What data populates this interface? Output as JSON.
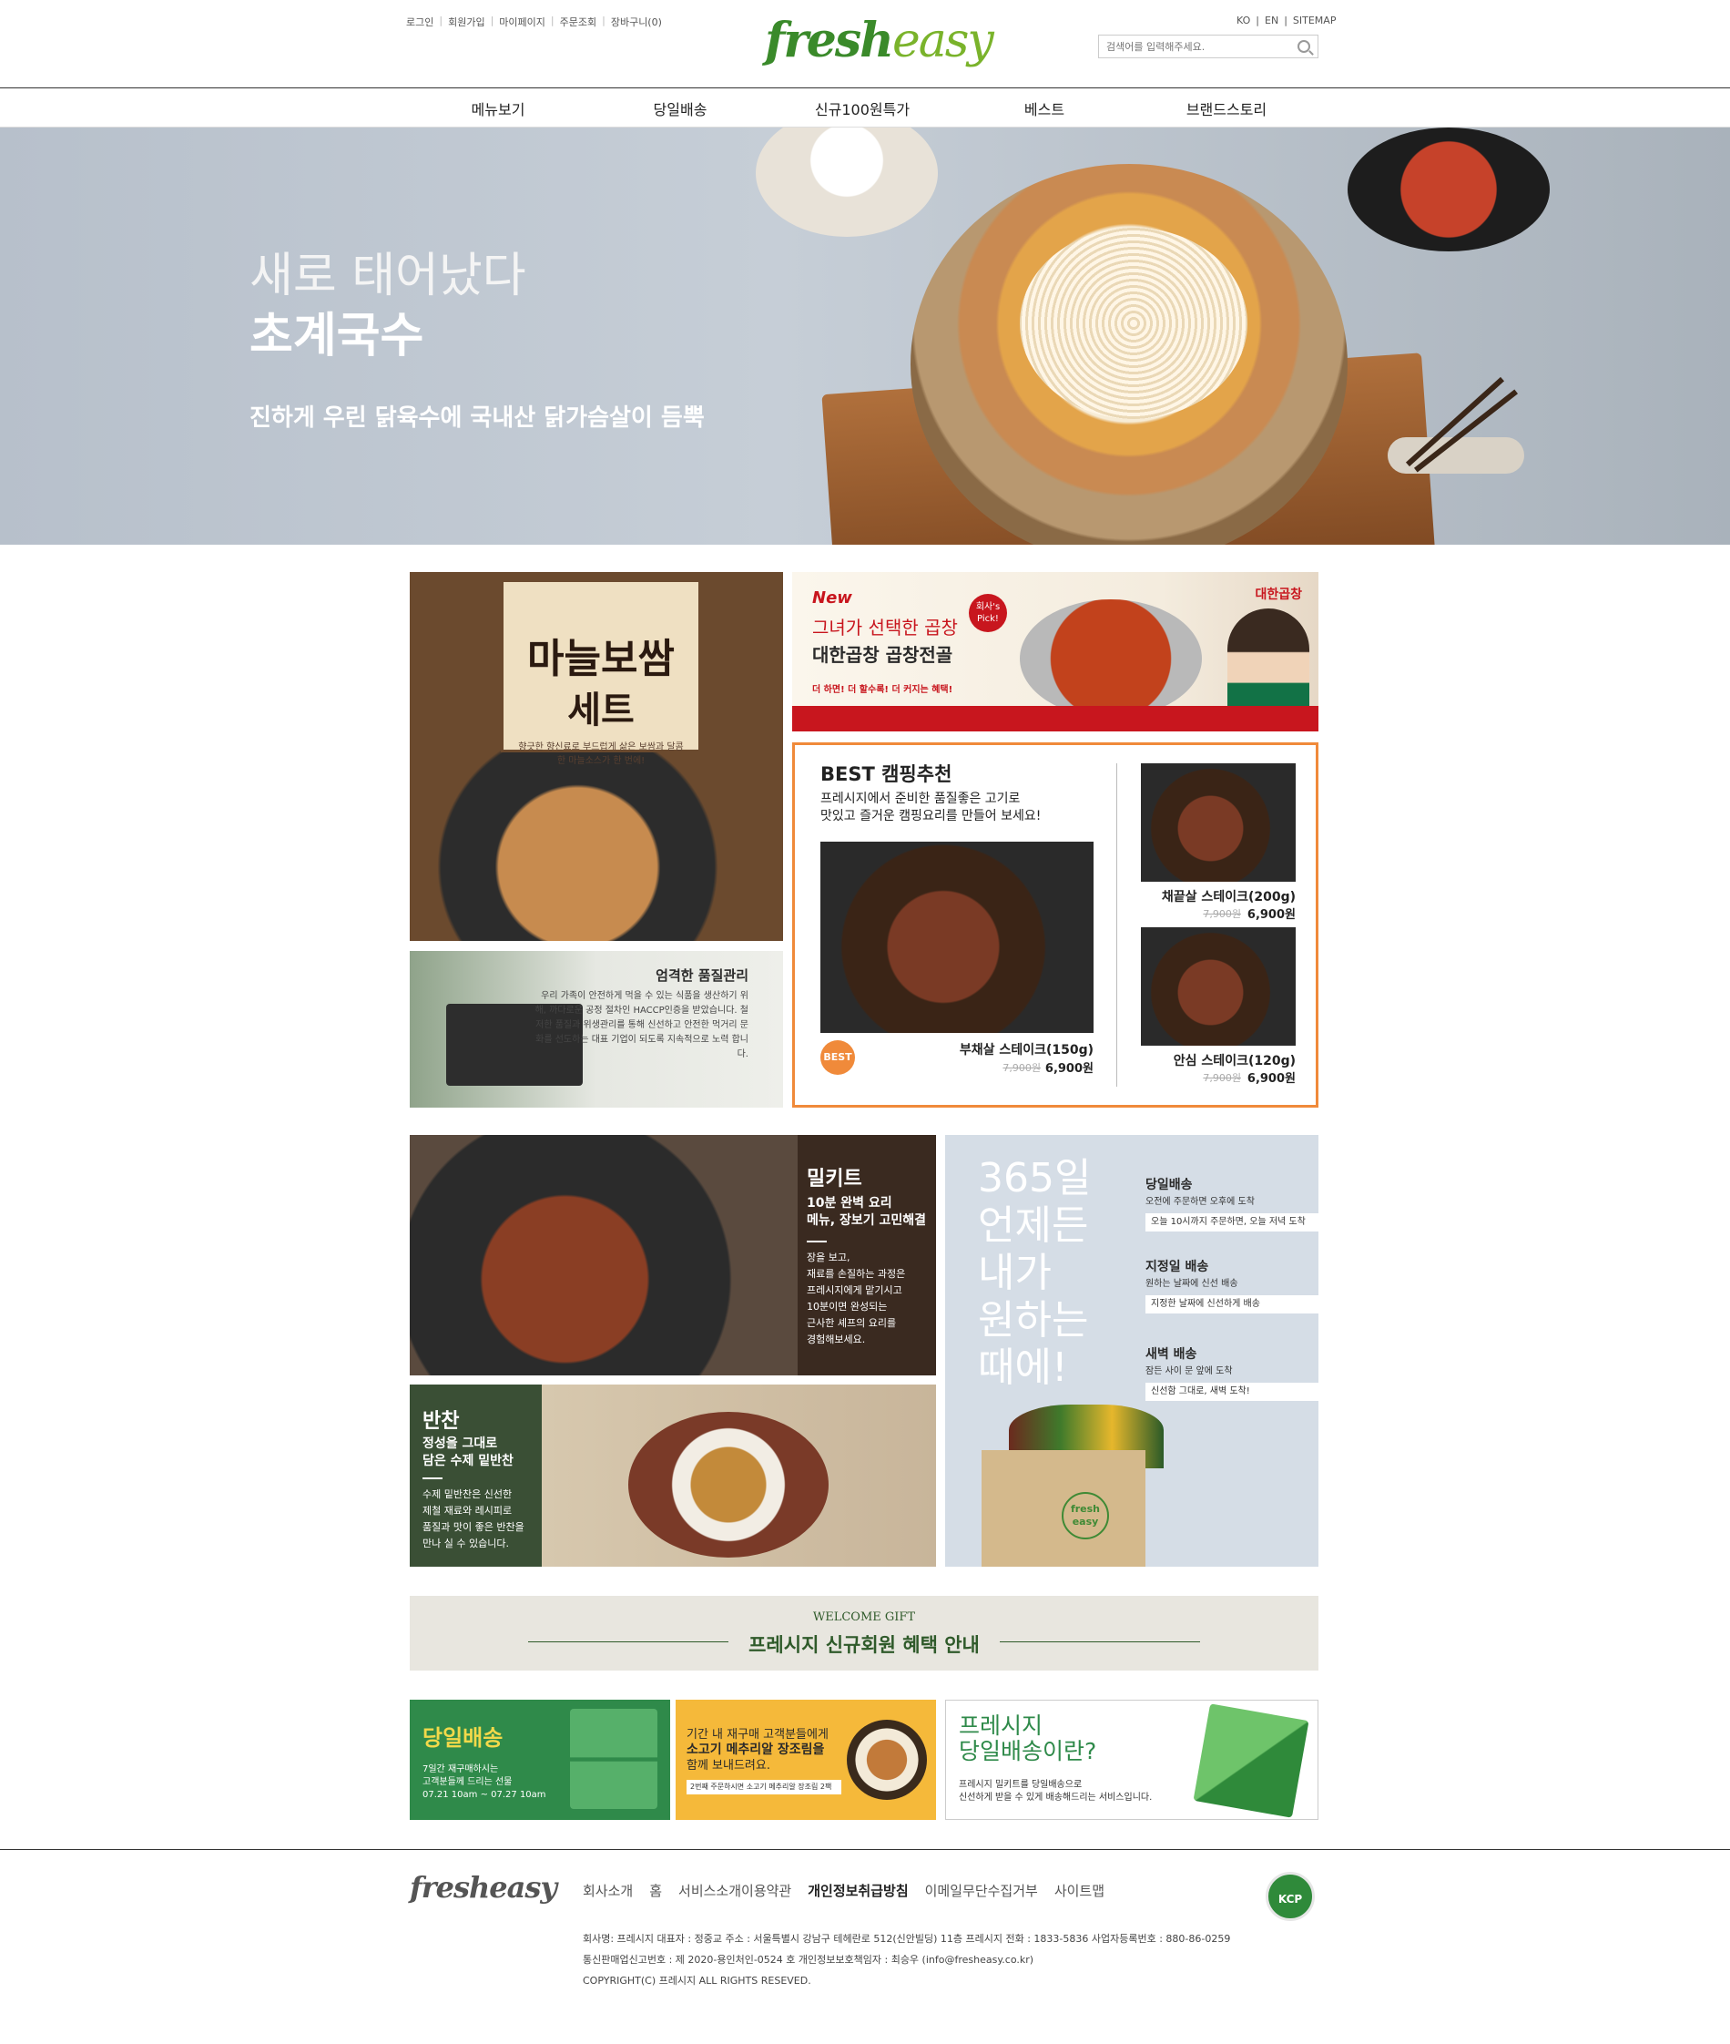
{
  "header": {
    "util_left": [
      "로그인",
      "회원가입",
      "마이페이지",
      "주문조회",
      "장바구니(0)"
    ],
    "logo_a": "fresh",
    "logo_b": "easy",
    "util_right": [
      "KO",
      "EN",
      "SITEMAP"
    ],
    "search_placeholder": "검색어를 입력해주세요."
  },
  "nav": [
    "메뉴보기",
    "당일배송",
    "신규100원특가",
    "베스트",
    "브랜드스토리"
  ],
  "hero": {
    "sub": "새로 태어났다",
    "title": "초계국수",
    "desc": "진하게 우린 닭육수에 국내산 닭가슴살이 듬뿍"
  },
  "bossam": {
    "title1": "마늘보쌈",
    "title2": "세트",
    "desc": "향긋한 향신료로 부드럽게 삶은 보쌈과 달콤한 마늘소스가 한 번에!"
  },
  "quality": {
    "title": "엄격한 품질관리",
    "desc": "우리 가족이 안전하게 먹을 수 있는 식품을 생산하기 위해, 까다로운 공정 절차인 HACCP인증을 받았습니다. 철저한 품질과 위생관리를 통해 신선하고 안전한 먹거리 문화를 선도하는 대표 기업이 되도록 지속적으로 노력 합니다."
  },
  "gopchang": {
    "new": "New",
    "line1": "그녀가 선택한 곱창",
    "line2": "대한곱창 곱창전골",
    "line3": "더 하면! 더 할수록! 더 커지는 혜택!",
    "pick": "회사's Pick!",
    "brand": "대한곱창"
  },
  "camping": {
    "title": "BEST 캠핑추천",
    "desc1": "프레시지에서 준비한 품질좋은 고기로",
    "desc2": "맛있고 즐거운 캠핑요리를 만들어 보세요!",
    "badge": "BEST",
    "products": [
      {
        "name": "부채살 스테이크(150g)",
        "old": "7,900원",
        "price": "6,900원"
      },
      {
        "name": "채끝살 스테이크(200g)",
        "old": "7,900원",
        "price": "6,900원"
      },
      {
        "name": "안심 스테이크(120g)",
        "old": "7,900원",
        "price": "6,900원"
      }
    ]
  },
  "mealkit": {
    "title": "밀키트",
    "sub1": "10분 완벽 요리",
    "sub2": "메뉴, 장보기 고민해결",
    "desc": [
      "장을 보고,",
      "재료를 손질하는 과정은",
      "프레시지에게 맡기시고",
      "10분이면 완성되는",
      "근사한 셰프의 요리를",
      "경험해보세요."
    ]
  },
  "banchan": {
    "title": "반찬",
    "sub1": "정성을 그대로",
    "sub2": "담은 수제 밑반찬",
    "desc": [
      "수제 밑반찬은 신선한",
      "제철 재료와 레시피로",
      "품질과 맛이 좋은 반찬을",
      "만나 실 수 있습니다."
    ]
  },
  "delivery": {
    "big": [
      "365일",
      "언제든",
      "내가",
      "원하는",
      "때에!"
    ],
    "items": [
      {
        "title": "당일배송",
        "sub": "오전에 주문하면 오후에 도착",
        "box": "오늘 10시까지 주문하면, 오늘 저녁 도착"
      },
      {
        "title": "지정일 배송",
        "sub": "원하는 날짜에 신선 배송",
        "box": "지정한 날짜에 신선하게 배송"
      },
      {
        "title": "새벽 배송",
        "sub": "잠든 사이 문 앞에 도착",
        "box": "신선함 그대로, 새벽 도착!"
      }
    ],
    "box_logo": "fresh easy"
  },
  "welcome": {
    "small": "WELCOME GIFT",
    "big": "프레시지 신규회원 혜택 안내"
  },
  "banner1": {
    "title": "당일배송",
    "d1": "7일간 재구매하시는",
    "d2": "고객분들께 드리는 선물",
    "d3": "07.21 10am ~ 07.27 10am"
  },
  "banner2": {
    "l1": "기간 내 재구매 고객분들에게",
    "l2": "소고기 메추리알 장조림을",
    "l3": "함께 보내드려요.",
    "pill": "2번째 주문하시면 소고기 메추리알 장조림 2팩"
  },
  "banner3": {
    "t1": "프레시지",
    "t2": "당일배송이란?",
    "d1": "프레시지 밀키트를 당일배송으로",
    "d2": "신선하게 받을 수 있게 배송해드리는 서비스입니다."
  },
  "footer": {
    "logo": "fresheasy",
    "links": [
      "회사소개",
      "홈",
      "서비스소개이용약관",
      "개인정보취급방침",
      "이메일무단수집거부",
      "사이트맵"
    ],
    "info1": "회사명: 프레시지   대표자 : 정중교   주소 : 서울특별시 강남구 테헤란로 512(신안빌딩) 11층 프레시지   전화 : 1833-5836   사업자등록번호 : 880-86-0259",
    "info2": "통신판매업신고번호 : 제 2020-용인처인-0524 호   개인정보보호책임자 : 최승우 (info@fresheasy.co.kr)",
    "info3": "COPYRIGHT(C) 프레시지 ALL RIGHTS RESEVED.",
    "kcp": "KCP"
  }
}
